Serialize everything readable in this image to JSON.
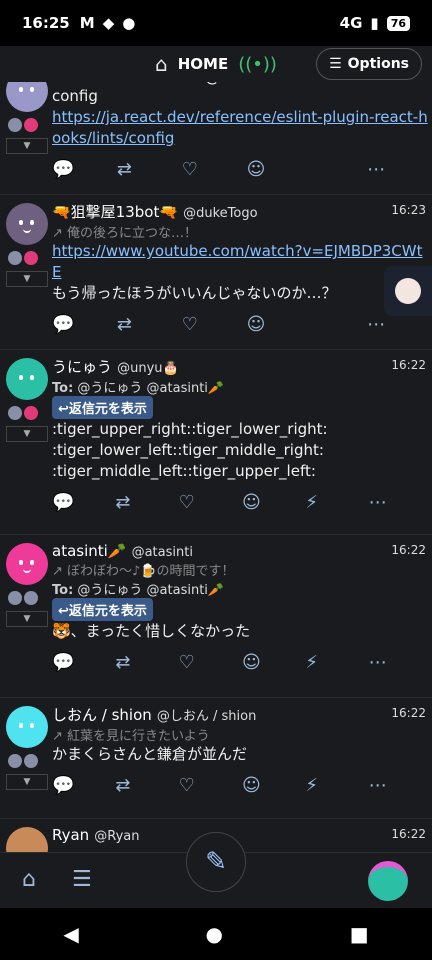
{
  "status": {
    "time": "16:25",
    "network": "4G",
    "battery": "76"
  },
  "header": {
    "title": "HOME",
    "options_label": "Options"
  },
  "notes": [
    {
      "name": "React Reference Bot@bot",
      "text_lines": [
        "config"
      ],
      "link_lines": [
        "https://ja.react.dev/reference/eslint-plugin-react-h",
        "ooks/lints/config"
      ]
    },
    {
      "name": "🔫狙撃屋13bot🔫",
      "handle": "@dukeTogo",
      "time": "16:23",
      "reply_text": "俺の後ろに立つな…！",
      "link_lines": [
        "https://www.youtube.com/watch?v=EJMBDP3CWt",
        "E"
      ],
      "text": "もう帰ったほうがいいんじゃないのか…？"
    },
    {
      "name": "うにゅう",
      "handle": "@unyu🎂",
      "time": "16:22",
      "to_label": "To:",
      "to_text": "@うにゅう @atasinti🥕",
      "reply_button": "返信元を表示",
      "text_lines": [
        ":tiger_upper_right::tiger_lower_right:",
        ":tiger_lower_left::tiger_middle_right:",
        ":tiger_middle_left::tiger_upper_left:"
      ]
    },
    {
      "name": "atasinti🥕",
      "handle": "@atasinti",
      "time": "16:22",
      "reply_text": "ぼわぼわ～♪🍺の時間です！",
      "to_label": "To:",
      "to_text": "@うにゅう @atasinti🥕",
      "reply_button": "返信元を表示",
      "text": "🐯、まったく惜しくなかった"
    },
    {
      "name": "しおん / shion",
      "handle": "@しおん / shion",
      "time": "16:22",
      "reply_text": "紅葉を見に行きたいよう",
      "text": "かまくらさんと鎌倉が並んだ"
    },
    {
      "name": "Ryan",
      "handle": "@Ryan",
      "time": "16:22"
    }
  ],
  "colors": {
    "accent": "#88c0ff",
    "bg": "#1a1b1f",
    "reply_btn": "#3a5a8a"
  }
}
